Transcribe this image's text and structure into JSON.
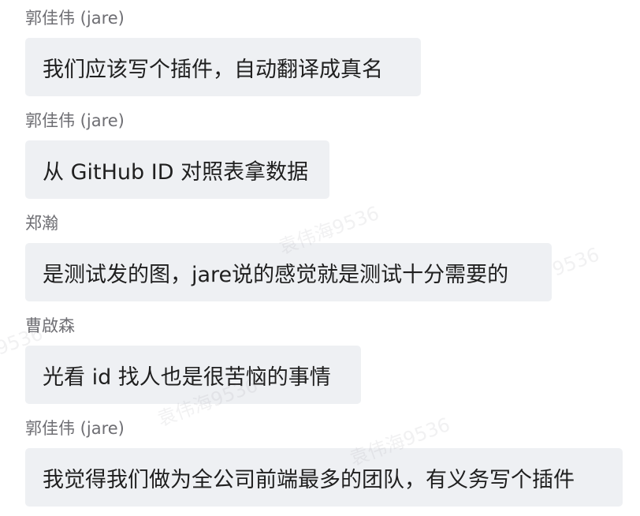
{
  "messages": [
    {
      "sender": "郭佳伟 (jare)",
      "text": "我们应该写个插件，自动翻译成真名"
    },
    {
      "sender": "郭佳伟 (jare)",
      "text": "从 GitHub ID 对照表拿数据"
    },
    {
      "sender": "郑瀚",
      "text": "是测试发的图，jare说的感觉就是测试十分需要的"
    },
    {
      "sender": "曹啟森",
      "text": "光看 id 找人也是很苦恼的事情"
    },
    {
      "sender": "郭佳伟 (jare)",
      "text": "我觉得我们做为全公司前端最多的团队，有义务写个插件"
    }
  ],
  "watermark": {
    "text": "袁伟海9536",
    "code": "9536"
  }
}
